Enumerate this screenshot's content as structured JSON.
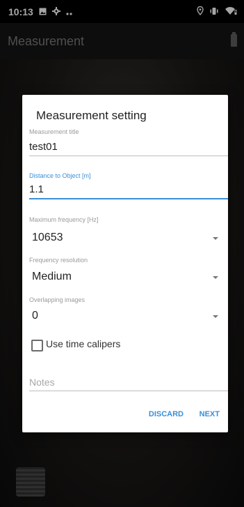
{
  "statusbar": {
    "time": "10:13",
    "left_icons": [
      "image-icon",
      "gear-icon",
      "more-dots-icon"
    ],
    "right_icons": [
      "location-icon",
      "vibrate-icon",
      "wifi-icon"
    ]
  },
  "appbar": {
    "title": "Measurement"
  },
  "dialog": {
    "title": "Measurement setting",
    "measurement_title": {
      "label": "Measurement title",
      "value": "test01"
    },
    "distance": {
      "label": "Distance to Object [m]",
      "value": "1.1"
    },
    "max_frequency": {
      "label": "Maximum frequency [Hz]",
      "value": "10653"
    },
    "frequency_resolution": {
      "label": "Frequency resolution",
      "value": "Medium"
    },
    "overlapping_images": {
      "label": "Overlapping images",
      "value": "0"
    },
    "time_calipers": {
      "label": "Use time calipers",
      "checked": false
    },
    "notes": {
      "placeholder": "Notes"
    },
    "discard_label": "DISCARD",
    "next_label": "NEXT"
  },
  "colors": {
    "accent": "#3a8fd6",
    "dialog_bg": "#ffffff",
    "statusbar_bg": "#000000"
  }
}
